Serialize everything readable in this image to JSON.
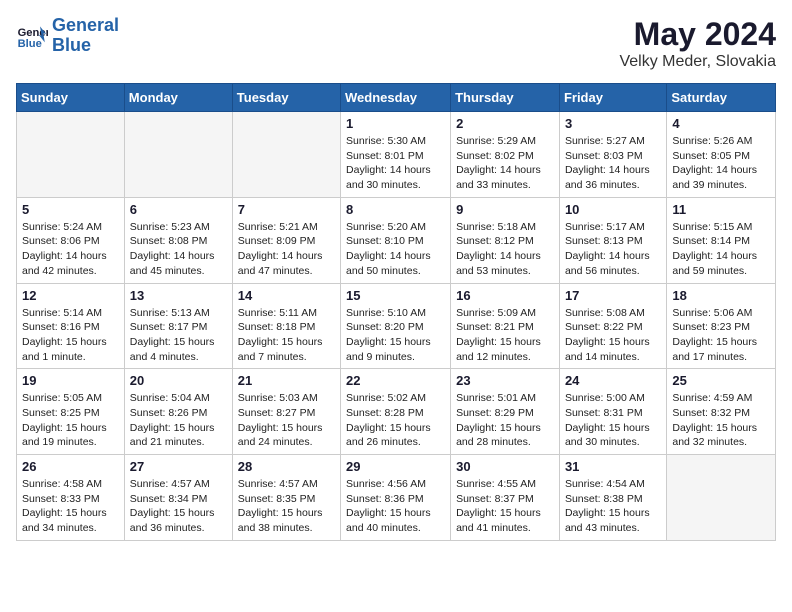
{
  "header": {
    "logo_line1": "General",
    "logo_line2": "Blue",
    "month_title": "May 2024",
    "location": "Velky Meder, Slovakia"
  },
  "weekdays": [
    "Sunday",
    "Monday",
    "Tuesday",
    "Wednesday",
    "Thursday",
    "Friday",
    "Saturday"
  ],
  "weeks": [
    [
      {
        "day": "",
        "empty": true
      },
      {
        "day": "",
        "empty": true
      },
      {
        "day": "",
        "empty": true
      },
      {
        "day": "1",
        "sunrise": "5:30 AM",
        "sunset": "8:01 PM",
        "daylight": "14 hours and 30 minutes."
      },
      {
        "day": "2",
        "sunrise": "5:29 AM",
        "sunset": "8:02 PM",
        "daylight": "14 hours and 33 minutes."
      },
      {
        "day": "3",
        "sunrise": "5:27 AM",
        "sunset": "8:03 PM",
        "daylight": "14 hours and 36 minutes."
      },
      {
        "day": "4",
        "sunrise": "5:26 AM",
        "sunset": "8:05 PM",
        "daylight": "14 hours and 39 minutes."
      }
    ],
    [
      {
        "day": "5",
        "sunrise": "5:24 AM",
        "sunset": "8:06 PM",
        "daylight": "14 hours and 42 minutes."
      },
      {
        "day": "6",
        "sunrise": "5:23 AM",
        "sunset": "8:08 PM",
        "daylight": "14 hours and 45 minutes."
      },
      {
        "day": "7",
        "sunrise": "5:21 AM",
        "sunset": "8:09 PM",
        "daylight": "14 hours and 47 minutes."
      },
      {
        "day": "8",
        "sunrise": "5:20 AM",
        "sunset": "8:10 PM",
        "daylight": "14 hours and 50 minutes."
      },
      {
        "day": "9",
        "sunrise": "5:18 AM",
        "sunset": "8:12 PM",
        "daylight": "14 hours and 53 minutes."
      },
      {
        "day": "10",
        "sunrise": "5:17 AM",
        "sunset": "8:13 PM",
        "daylight": "14 hours and 56 minutes."
      },
      {
        "day": "11",
        "sunrise": "5:15 AM",
        "sunset": "8:14 PM",
        "daylight": "14 hours and 59 minutes."
      }
    ],
    [
      {
        "day": "12",
        "sunrise": "5:14 AM",
        "sunset": "8:16 PM",
        "daylight": "15 hours and 1 minute."
      },
      {
        "day": "13",
        "sunrise": "5:13 AM",
        "sunset": "8:17 PM",
        "daylight": "15 hours and 4 minutes."
      },
      {
        "day": "14",
        "sunrise": "5:11 AM",
        "sunset": "8:18 PM",
        "daylight": "15 hours and 7 minutes."
      },
      {
        "day": "15",
        "sunrise": "5:10 AM",
        "sunset": "8:20 PM",
        "daylight": "15 hours and 9 minutes."
      },
      {
        "day": "16",
        "sunrise": "5:09 AM",
        "sunset": "8:21 PM",
        "daylight": "15 hours and 12 minutes."
      },
      {
        "day": "17",
        "sunrise": "5:08 AM",
        "sunset": "8:22 PM",
        "daylight": "15 hours and 14 minutes."
      },
      {
        "day": "18",
        "sunrise": "5:06 AM",
        "sunset": "8:23 PM",
        "daylight": "15 hours and 17 minutes."
      }
    ],
    [
      {
        "day": "19",
        "sunrise": "5:05 AM",
        "sunset": "8:25 PM",
        "daylight": "15 hours and 19 minutes."
      },
      {
        "day": "20",
        "sunrise": "5:04 AM",
        "sunset": "8:26 PM",
        "daylight": "15 hours and 21 minutes."
      },
      {
        "day": "21",
        "sunrise": "5:03 AM",
        "sunset": "8:27 PM",
        "daylight": "15 hours and 24 minutes."
      },
      {
        "day": "22",
        "sunrise": "5:02 AM",
        "sunset": "8:28 PM",
        "daylight": "15 hours and 26 minutes."
      },
      {
        "day": "23",
        "sunrise": "5:01 AM",
        "sunset": "8:29 PM",
        "daylight": "15 hours and 28 minutes."
      },
      {
        "day": "24",
        "sunrise": "5:00 AM",
        "sunset": "8:31 PM",
        "daylight": "15 hours and 30 minutes."
      },
      {
        "day": "25",
        "sunrise": "4:59 AM",
        "sunset": "8:32 PM",
        "daylight": "15 hours and 32 minutes."
      }
    ],
    [
      {
        "day": "26",
        "sunrise": "4:58 AM",
        "sunset": "8:33 PM",
        "daylight": "15 hours and 34 minutes."
      },
      {
        "day": "27",
        "sunrise": "4:57 AM",
        "sunset": "8:34 PM",
        "daylight": "15 hours and 36 minutes."
      },
      {
        "day": "28",
        "sunrise": "4:57 AM",
        "sunset": "8:35 PM",
        "daylight": "15 hours and 38 minutes."
      },
      {
        "day": "29",
        "sunrise": "4:56 AM",
        "sunset": "8:36 PM",
        "daylight": "15 hours and 40 minutes."
      },
      {
        "day": "30",
        "sunrise": "4:55 AM",
        "sunset": "8:37 PM",
        "daylight": "15 hours and 41 minutes."
      },
      {
        "day": "31",
        "sunrise": "4:54 AM",
        "sunset": "8:38 PM",
        "daylight": "15 hours and 43 minutes."
      },
      {
        "day": "",
        "empty": true
      }
    ]
  ]
}
